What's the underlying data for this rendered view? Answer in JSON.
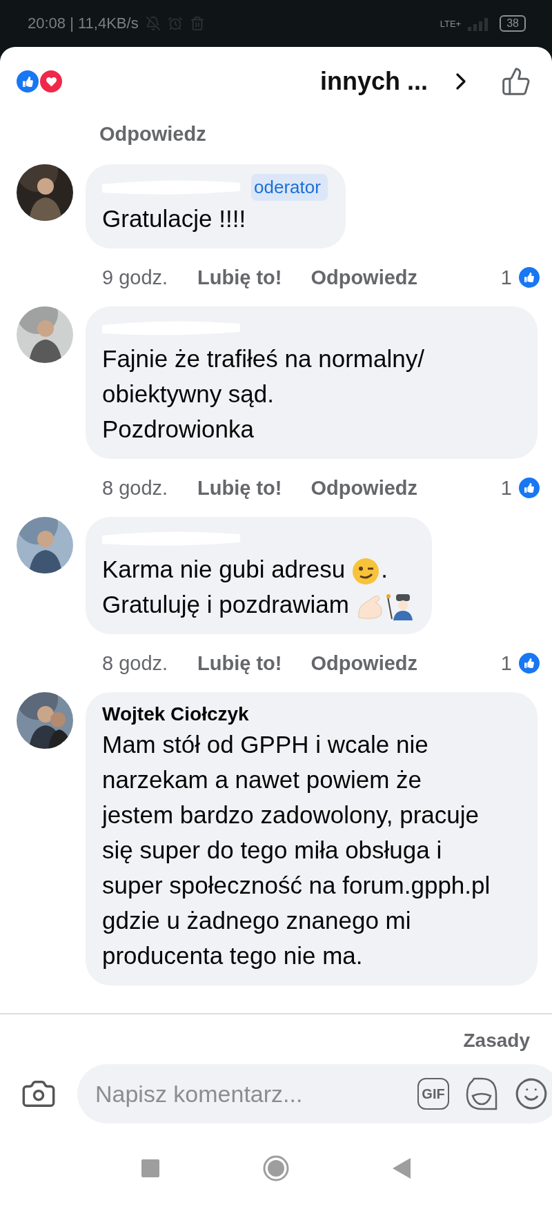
{
  "status_bar": {
    "time": "20:08 | 11,4KB/s",
    "network": "LTE+",
    "battery": "38"
  },
  "header": {
    "title": "innych ..."
  },
  "top_reply": {
    "label": "Odpowiedz"
  },
  "comments": [
    {
      "badge": "oderator",
      "parts": [
        {
          "kind": "text",
          "text": "Gratulacje !!!!"
        }
      ],
      "time": "9 godz.",
      "like_label": "Lubię to!",
      "reply_label": "Odpowiedz",
      "like_count": "1"
    },
    {
      "parts": [
        {
          "kind": "text",
          "text": "Fajnie że trafiłeś na normalny/\nobiektywny sąd.\nPozdrowionka"
        }
      ],
      "time": "8 godz.",
      "like_label": "Lubię to!",
      "reply_label": "Odpowiedz",
      "like_count": "1"
    },
    {
      "parts": [
        {
          "kind": "text",
          "text": "Karma nie gubi adresu"
        },
        {
          "kind": "wink"
        },
        {
          "kind": "text",
          "text": "."
        },
        {
          "kind": "break"
        },
        {
          "kind": "text",
          "text": "Gratuluję i pozdrawiam"
        },
        {
          "kind": "arm"
        },
        {
          "kind": "welder"
        }
      ],
      "time": "8 godz.",
      "like_label": "Lubię to!",
      "reply_label": "Odpowiedz",
      "like_count": "1"
    },
    {
      "name": "Wojtek Ciołczyk",
      "parts": [
        {
          "kind": "text",
          "text": "Mam stół od GPPH i wcale nie narzekam a nawet powiem że jestem bardzo zadowolony, pracuje się super do tego miła obsługa i super społeczność na forum.gpph.pl gdzie u żadnego znanego mi producenta tego nie ma."
        }
      ]
    }
  ],
  "footer": {
    "rules_link": "Zasady",
    "placeholder": "Napisz komentarz...",
    "gif_label": "GIF"
  }
}
